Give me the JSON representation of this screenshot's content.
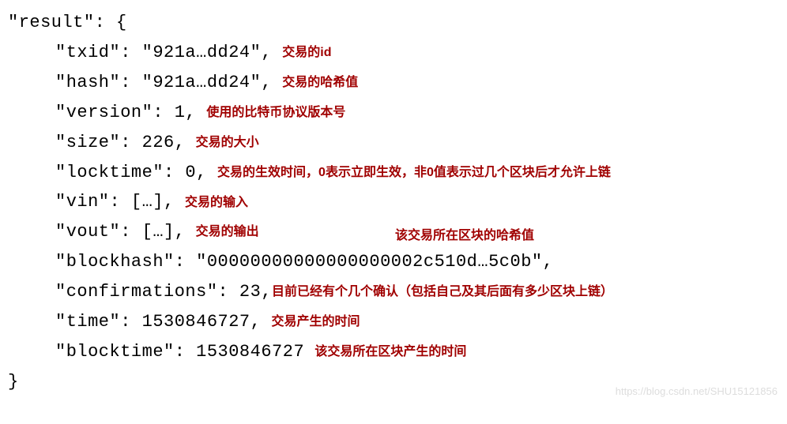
{
  "result_open": "\"result\": {",
  "lines": {
    "txid": {
      "code": "\"txid\": \"921a…dd24\",",
      "note": "交易的id"
    },
    "hash": {
      "code": "\"hash\": \"921a…dd24\",",
      "note": "交易的哈希值"
    },
    "version": {
      "code": "\"version\": 1,",
      "note": "使用的比特币协议版本号"
    },
    "size": {
      "code": "\"size\": 226,",
      "note": "交易的大小"
    },
    "locktime": {
      "code": "\"locktime\": 0,",
      "note": "交易的生效时间，0表示立即生效，非0值表示过几个区块后才允许上链"
    },
    "vin": {
      "code": "\"vin\": […],",
      "note": "交易的输入"
    },
    "vout": {
      "code": "\"vout\": […],",
      "note": "交易的输出"
    },
    "blockhash": {
      "code": "\"blockhash\": \"00000000000000000002c510d…5c0b\",",
      "note": "该交易所在区块的哈希值"
    },
    "confirmations": {
      "code": "\"confirmations\": 23,",
      "note": "目前已经有个几个确认（包括自己及其后面有多少区块上链）"
    },
    "time": {
      "code": "\"time\": 1530846727,",
      "note": "交易产生的时间"
    },
    "blocktime": {
      "code": "\"blocktime\": 1530846727",
      "note": "该交易所在区块产生的时间"
    }
  },
  "close_brace": "}",
  "watermark": "https://blog.csdn.net/SHU15121856"
}
